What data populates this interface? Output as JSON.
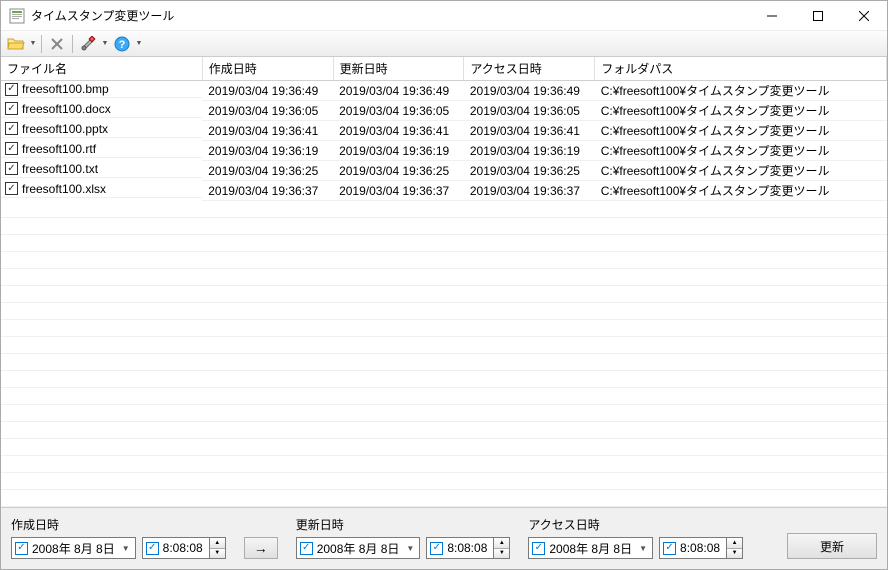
{
  "window": {
    "title": "タイムスタンプ変更ツール"
  },
  "columns": {
    "filename": "ファイル名",
    "created": "作成日時",
    "modified": "更新日時",
    "accessed": "アクセス日時",
    "folder": "フォルダパス"
  },
  "col_widths": {
    "filename": 200,
    "created": 130,
    "modified": 130,
    "accessed": 130,
    "folder": 290
  },
  "rows": [
    {
      "name": "freesoft100.bmp",
      "created": "2019/03/04 19:36:49",
      "modified": "2019/03/04 19:36:49",
      "accessed": "2019/03/04 19:36:49",
      "folder": "C:¥freesoft100¥タイムスタンプ変更ツール"
    },
    {
      "name": "freesoft100.docx",
      "created": "2019/03/04 19:36:05",
      "modified": "2019/03/04 19:36:05",
      "accessed": "2019/03/04 19:36:05",
      "folder": "C:¥freesoft100¥タイムスタンプ変更ツール"
    },
    {
      "name": "freesoft100.pptx",
      "created": "2019/03/04 19:36:41",
      "modified": "2019/03/04 19:36:41",
      "accessed": "2019/03/04 19:36:41",
      "folder": "C:¥freesoft100¥タイムスタンプ変更ツール"
    },
    {
      "name": "freesoft100.rtf",
      "created": "2019/03/04 19:36:19",
      "modified": "2019/03/04 19:36:19",
      "accessed": "2019/03/04 19:36:19",
      "folder": "C:¥freesoft100¥タイムスタンプ変更ツール"
    },
    {
      "name": "freesoft100.txt",
      "created": "2019/03/04 19:36:25",
      "modified": "2019/03/04 19:36:25",
      "accessed": "2019/03/04 19:36:25",
      "folder": "C:¥freesoft100¥タイムスタンプ変更ツール"
    },
    {
      "name": "freesoft100.xlsx",
      "created": "2019/03/04 19:36:37",
      "modified": "2019/03/04 19:36:37",
      "accessed": "2019/03/04 19:36:37",
      "folder": "C:¥freesoft100¥タイムスタンプ変更ツール"
    }
  ],
  "bottom": {
    "created_label": "作成日時",
    "modified_label": "更新日時",
    "accessed_label": "アクセス日時",
    "date_value": "2008年  8月  8日",
    "time_value": "8:08:08",
    "arrow": "→",
    "update_label": "更新"
  }
}
